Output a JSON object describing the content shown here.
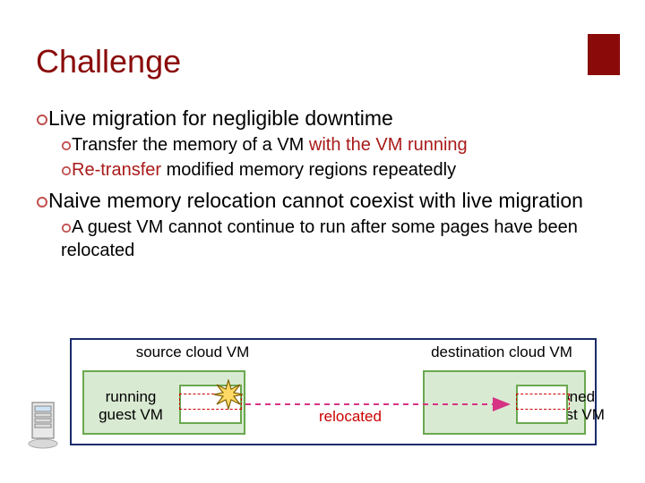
{
  "colors": {
    "accent": "#8a0a0a",
    "hollow_bullet": "#c0504d",
    "red_text": "#aa1a1a",
    "diagram_border": "#1a2b6b",
    "vm_border": "#6aa84f",
    "vm_fill": "#d9ead3",
    "relocate_red": "#cc0000",
    "arrow_magenta": "#d63384"
  },
  "title": "Challenge",
  "bullets": {
    "b1": "Live migration for negligible downtime",
    "b1a_pre": "Transfer the memory of a VM ",
    "b1a_red": "with the VM running",
    "b1b_red": "Re-transfer",
    "b1b_post": " modified memory regions repeatedly",
    "b2": "Naive memory relocation cannot coexist with live migration",
    "b2a": "A guest VM cannot continue to run after some pages have been relocated"
  },
  "diagram": {
    "source_label": "source cloud VM",
    "dest_label": "destination cloud VM",
    "running_guest": "running\nguest VM",
    "cloned_guest": "cloned\nguest VM",
    "relocated": "relocated"
  }
}
